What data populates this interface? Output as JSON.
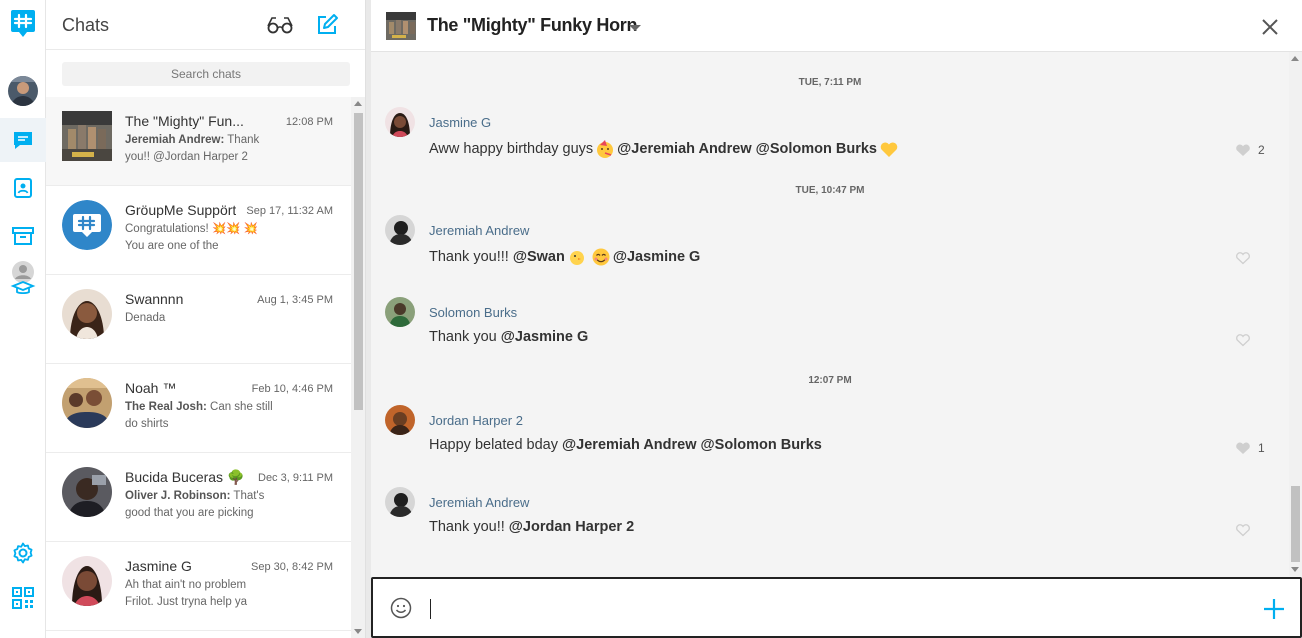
{
  "colors": {
    "accent": "#00aff0",
    "name_blue": "#4a6d8a",
    "background_conv": "#f4f4f4"
  },
  "rail": {
    "items": [
      {
        "name": "groupme-logo-icon"
      },
      {
        "name": "profile-avatar"
      },
      {
        "name": "chats-icon"
      },
      {
        "name": "contacts-icon"
      },
      {
        "name": "archive-icon"
      },
      {
        "name": "campus-icon"
      },
      {
        "name": "settings-icon"
      },
      {
        "name": "qr-code-icon"
      }
    ]
  },
  "list": {
    "title": "Chats",
    "search_placeholder": "Search chats",
    "chats": [
      {
        "name": "The \"Mighty\" Fun...",
        "time": "12:08 PM",
        "sender": "Jeremiah Andrew:",
        "preview": " Thank you!! @Jordan Harper 2"
      },
      {
        "name": "GröupMe Suppört",
        "time": "Sep 17, 11:32 AM",
        "sender": "",
        "preview": "Congratulations! 💥💥 💥 You are one of the"
      },
      {
        "name": "Swannnn",
        "time": "Aug 1, 3:45 PM",
        "sender": "",
        "preview": "Denada"
      },
      {
        "name": "Noah ™",
        "time": "Feb 10, 4:46 PM",
        "sender": "The Real Josh:",
        "preview": " Can she still do shirts"
      },
      {
        "name": "Bucida Buceras 🌳",
        "time": "Dec 3, 9:11 PM",
        "sender": "Oliver J. Robinson:",
        "preview": " That's good that you are picking"
      },
      {
        "name": "Jasmine G",
        "time": "Sep 30, 8:42 PM",
        "sender": "",
        "preview": "Ah that ain't no problem Frilot. Just tryna help ya"
      }
    ]
  },
  "conversation": {
    "title": "The \"Mighty\" Funky Horn",
    "separators": [
      "TUE, 7:11 PM",
      "TUE, 10:47 PM",
      "12:07 PM"
    ],
    "messages": [
      {
        "author": "Jasmine G",
        "text": "Aww happy birthday guys",
        "mentions": "@Jeremiah Andrew @Solomon Burks",
        "likes": "2"
      },
      {
        "author": "Jeremiah Andrew",
        "text": "Thank you!!!",
        "mentions": "@Swan",
        "mentions2": "@Jasmine G",
        "likes": ""
      },
      {
        "author": "Solomon Burks",
        "text": "Thank you",
        "mentions": "@Jasmine G",
        "likes": ""
      },
      {
        "author": "Jordan Harper 2",
        "text": "Happy belated bday",
        "mentions": "@Jeremiah Andrew @Solomon Burks",
        "likes": "1"
      },
      {
        "author": "Jeremiah Andrew",
        "text": "Thank you!!",
        "mentions": "@Jordan Harper 2",
        "likes": ""
      }
    ]
  },
  "composer": {
    "value": ""
  }
}
